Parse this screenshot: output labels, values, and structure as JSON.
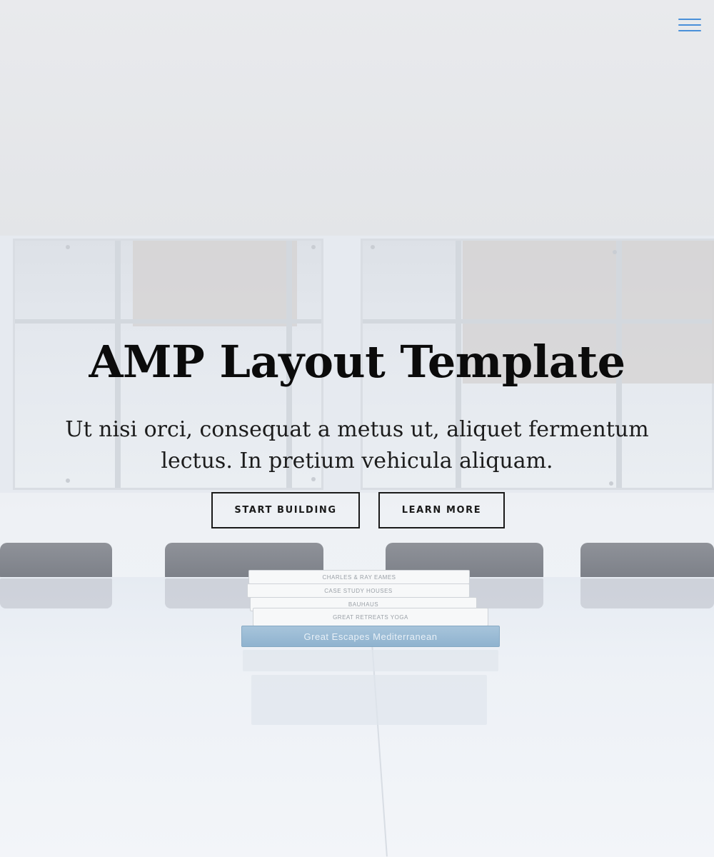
{
  "hero": {
    "title": "AMP Layout Template",
    "subtitle": "Ut nisi orci, consequat a metus ut, aliquet fermentum lectus. In pretium vehicula aliquam.",
    "buttons": {
      "primary_label": "START BUILDING",
      "secondary_label": "LEARN MORE"
    }
  },
  "header": {
    "menu_icon": "hamburger-menu-icon",
    "menu_color": "#4a90d9"
  },
  "background": {
    "books": [
      "CHARLES & RAY EAMES",
      "CASE STUDY HOUSES",
      "BAUHAUS",
      "GREAT RETREATS   YOGA",
      "Great Escapes Mediterranean"
    ]
  }
}
